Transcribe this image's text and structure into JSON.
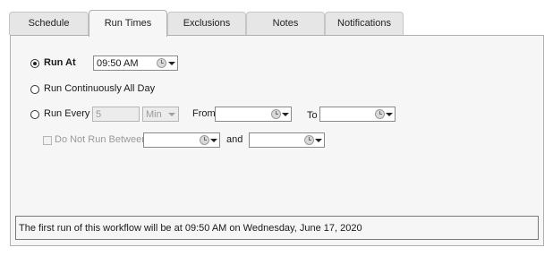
{
  "tabs": [
    {
      "label": "Schedule"
    },
    {
      "label": "Run Times",
      "active": true
    },
    {
      "label": "Exclusions"
    },
    {
      "label": "Notes"
    },
    {
      "label": "Notifications"
    }
  ],
  "run_at": {
    "label": "Run At",
    "selected": true,
    "time": "09:50 AM"
  },
  "run_continuously": {
    "label": "Run Continuously All Day",
    "selected": false
  },
  "run_every": {
    "label": "Run Every",
    "selected": false,
    "interval": "5",
    "unit": "Min",
    "from_label": "From",
    "from_value": "",
    "to_label": "To",
    "to_value": ""
  },
  "do_not_run": {
    "label": "Do Not Run Between",
    "checked": false,
    "enabled": false,
    "start_value": "",
    "and_label": "and",
    "end_value": ""
  },
  "status_message": "The first run of this workflow will be at 09:50 AM on Wednesday, June 17, 2020",
  "colors": {
    "panel_bg": "#f6f6f6",
    "tab_bg": "#e6e6e6",
    "border": "#b0b0b0"
  }
}
